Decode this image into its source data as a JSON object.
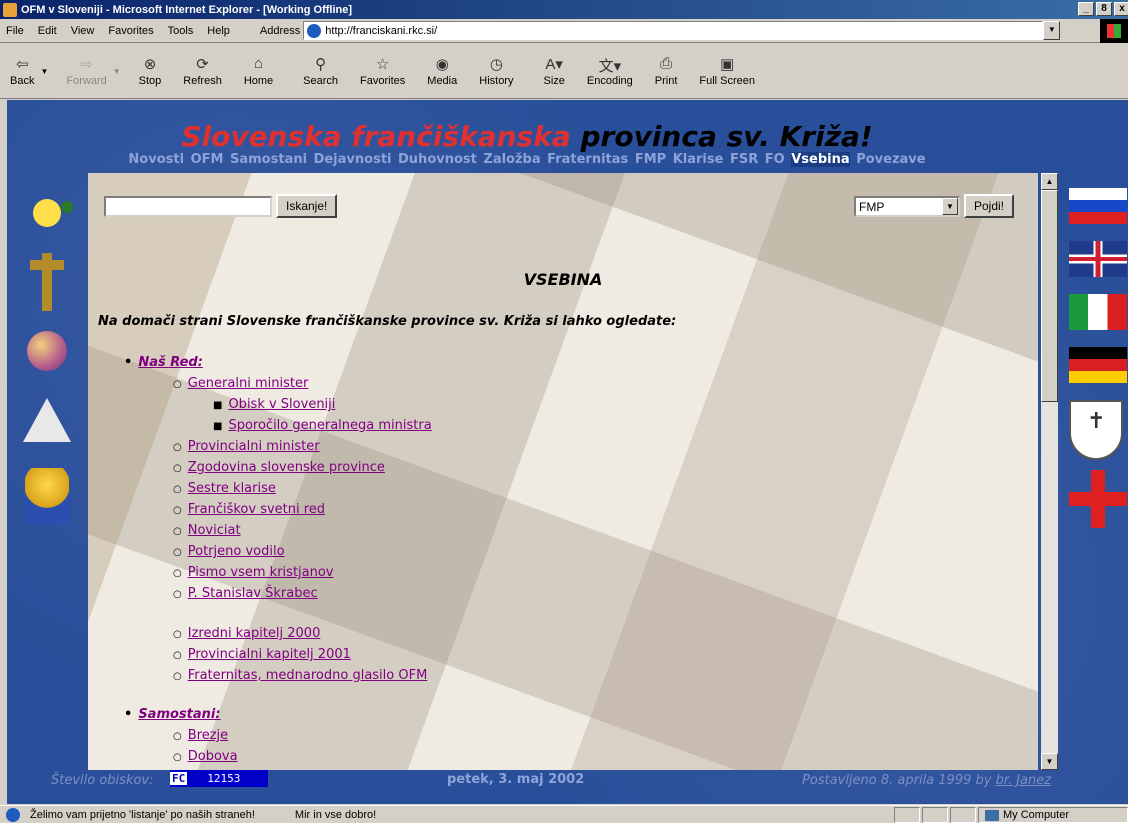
{
  "window": {
    "title": "OFM v Sloveniji - Microsoft Internet Explorer - [Working Offline]",
    "controls": [
      "_",
      "8",
      "x"
    ]
  },
  "menu": [
    "File",
    "Edit",
    "View",
    "Favorites",
    "Tools",
    "Help"
  ],
  "address": {
    "label": "Address",
    "url": "http://franciskani.rkc.si/"
  },
  "toolbar": [
    {
      "label": "Back",
      "icon": "back-arrow-icon",
      "glyph": "⇦"
    },
    {
      "label": "Forward",
      "icon": "forward-arrow-icon",
      "glyph": "⇨"
    },
    {
      "label": "Stop",
      "icon": "stop-icon",
      "glyph": "⊗"
    },
    {
      "label": "Refresh",
      "icon": "refresh-icon",
      "glyph": "⟳"
    },
    {
      "label": "Home",
      "icon": "home-icon",
      "glyph": "⌂"
    },
    {
      "label": "Search",
      "icon": "search-icon",
      "glyph": "⚲"
    },
    {
      "label": "Favorites",
      "icon": "favorites-icon",
      "glyph": "☆"
    },
    {
      "label": "Media",
      "icon": "media-icon",
      "glyph": "◉"
    },
    {
      "label": "History",
      "icon": "history-icon",
      "glyph": "◷"
    },
    {
      "label": "Size",
      "icon": "size-icon",
      "glyph": "A"
    },
    {
      "label": "Encoding",
      "icon": "encoding-icon",
      "glyph": "文"
    },
    {
      "label": "Print",
      "icon": "print-icon",
      "glyph": "⎙"
    },
    {
      "label": "Full Screen",
      "icon": "fullscreen-icon",
      "glyph": "▣"
    }
  ],
  "site": {
    "title_part1": "Slovenska frančiškanska",
    "title_part2": " provinca sv. Križa!",
    "nav": [
      "Novosti",
      "OFM",
      "Samostani",
      "Dejavnosti",
      "Duhovnost",
      "Založba",
      "Fraternitas",
      "FMP",
      "Klarise",
      "FSR",
      "FO",
      "Vsebina",
      "Povezave"
    ],
    "nav_active": "Vsebina",
    "search_button": "Iskanje!",
    "select_value": "FMP",
    "go_button": "Pojdi!",
    "heading": "VSEBINA",
    "intro": "Na domači strani Slovenske frančiškanske province sv. Križa si lahko ogledate:",
    "section1": "Naš Red:",
    "items": [
      "Generalni minister",
      "Obisk v Sloveniji",
      "Sporočilo generalnega ministra",
      "Provincialni minister",
      "Zgodovina slovenske province",
      "Sestre klarise",
      "Frančiškov svetni red",
      "Noviciat",
      "Potrjeno vodilo",
      "Pismo vsem kristjanov",
      "P. Stanislav Škrabec",
      "Izredni kapitelj 2000",
      "Provincialni kapitelj 2001",
      "Fraternitas, mednarodno glasilo OFM"
    ],
    "section2": "Samostani:",
    "items2": [
      "Brezje",
      "Dobova"
    ],
    "footer": {
      "visits_label": "Število obiskov:",
      "counter_badge": "FC",
      "counter_value": "12153",
      "date": "petek, 3. maj 2002",
      "posted_prefix": "Postavljeno 8. aprila 1999 by ",
      "posted_author": "br. Janez"
    }
  },
  "status": {
    "message1": "Želimo vam prijetno 'listanje' po naših straneh!",
    "message2": "Mir in vse dobro!",
    "zone": "My Computer"
  },
  "colors": {
    "title_red": "#e03030",
    "link_visited": "#800080",
    "page_bg": "#2a4f9a"
  }
}
